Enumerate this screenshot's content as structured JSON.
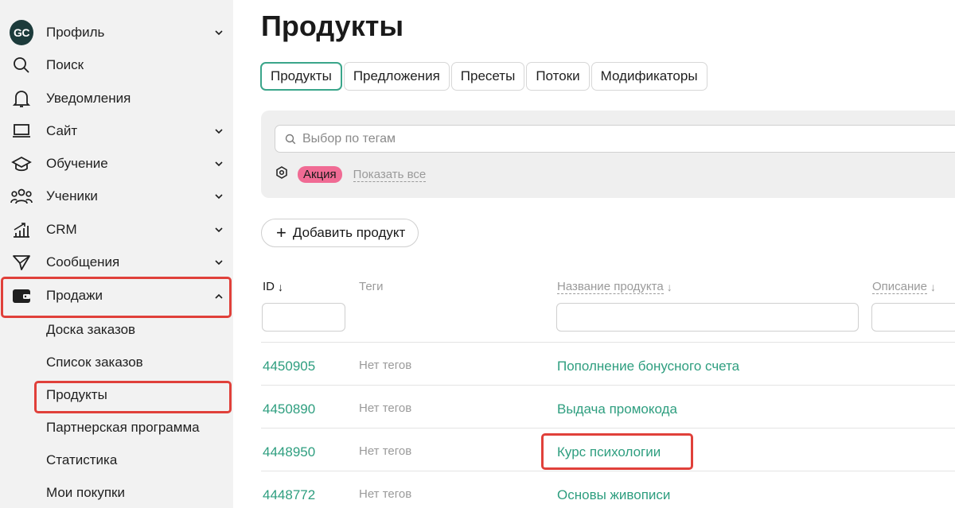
{
  "sidebar": {
    "logo": "GC",
    "items": [
      {
        "label": "Профиль"
      },
      {
        "label": "Поиск"
      },
      {
        "label": "Уведомления"
      },
      {
        "label": "Сайт"
      },
      {
        "label": "Обучение"
      },
      {
        "label": "Ученики"
      },
      {
        "label": "CRM"
      },
      {
        "label": "Сообщения"
      },
      {
        "label": "Продажи"
      }
    ],
    "sales_subitems": [
      {
        "label": "Доска заказов"
      },
      {
        "label": "Список заказов"
      },
      {
        "label": "Продукты"
      },
      {
        "label": "Партнерская программа"
      },
      {
        "label": "Статистика"
      },
      {
        "label": "Мои покупки"
      }
    ]
  },
  "main": {
    "title": "Продукты",
    "tabs": [
      {
        "label": "Продукты",
        "active": true
      },
      {
        "label": "Предложения"
      },
      {
        "label": "Пресеты"
      },
      {
        "label": "Потоки"
      },
      {
        "label": "Модификаторы"
      }
    ],
    "tag_filter": {
      "placeholder": "Выбор по тегам",
      "tag": "Акция",
      "tag_color": "#f06b94",
      "show_all": "Показать все"
    },
    "add_button": "Добавить продукт",
    "table": {
      "columns": {
        "id": "ID",
        "tags": "Теги",
        "name": "Название продукта",
        "description": "Описание"
      },
      "rows": [
        {
          "id": "4450905",
          "tags": "Нет тегов",
          "name": "Пополнение бонусного счета"
        },
        {
          "id": "4450890",
          "tags": "Нет тегов",
          "name": "Выдача промокода"
        },
        {
          "id": "4448950",
          "tags": "Нет тегов",
          "name": "Курс психологии"
        },
        {
          "id": "4448772",
          "tags": "Нет тегов",
          "name": "Основы живописи"
        }
      ]
    }
  },
  "colors": {
    "accent": "#2e9e7f",
    "highlight": "#e0403a",
    "sidebar_bg": "#f2f2f2"
  }
}
